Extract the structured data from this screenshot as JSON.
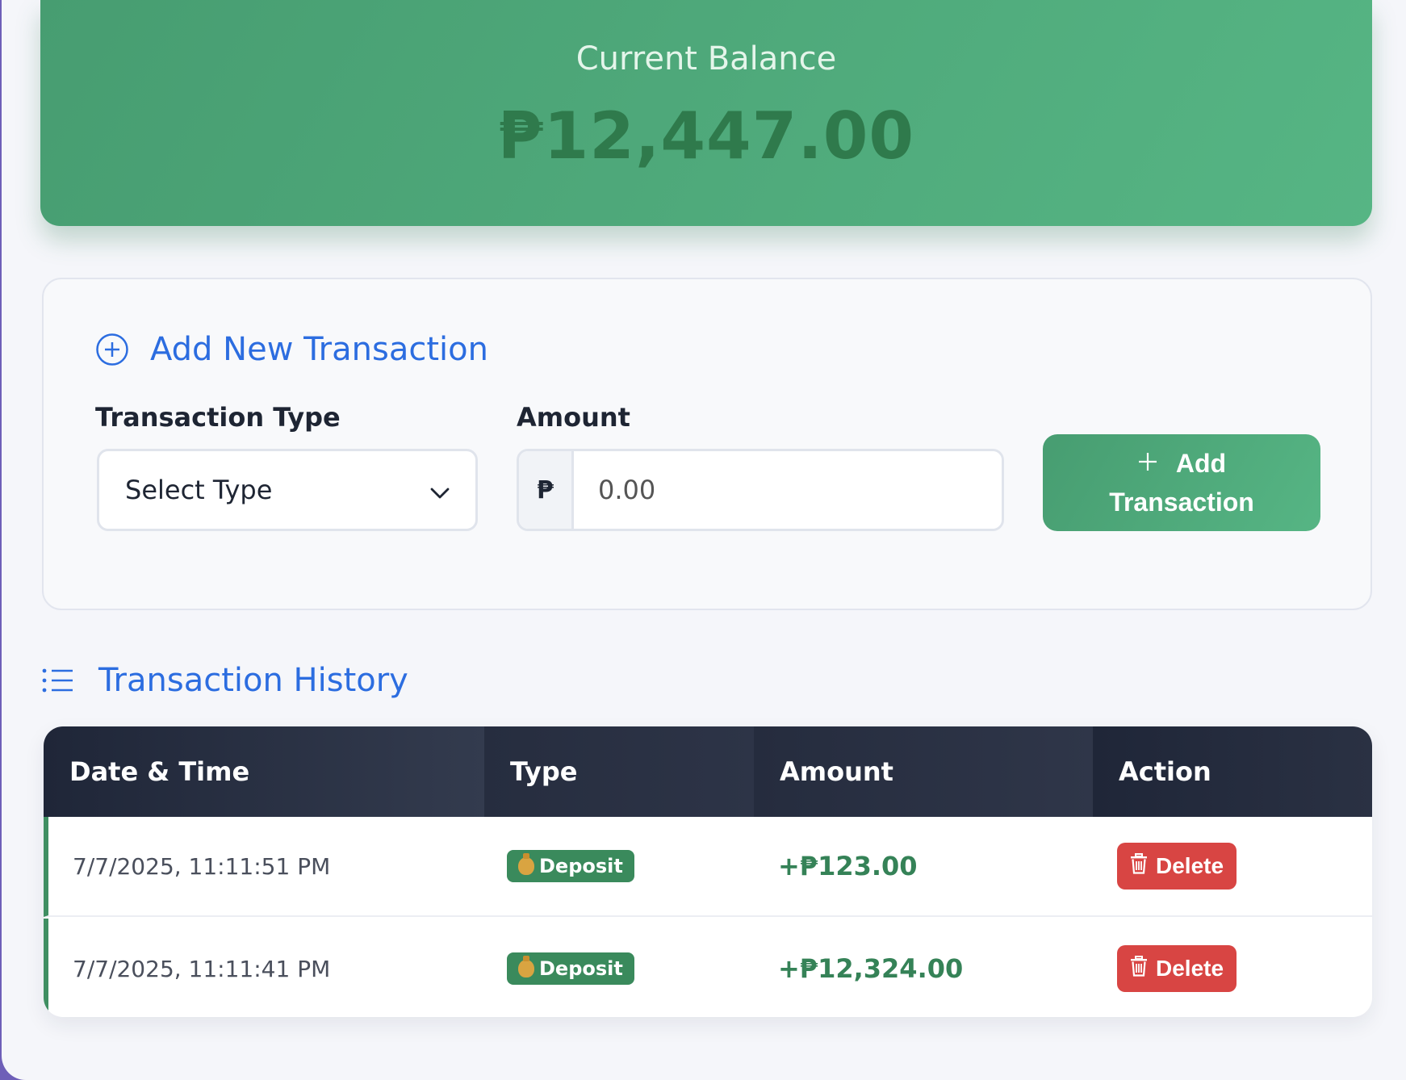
{
  "balance": {
    "label": "Current Balance",
    "value": "₱12,447.00"
  },
  "form": {
    "title": "Add New Transaction",
    "type_label": "Transaction Type",
    "type_selected": "Select Type",
    "amount_label": "Amount",
    "currency_symbol": "₱",
    "amount_placeholder": "0.00",
    "submit_line1": "Add",
    "submit_line2": "Transaction"
  },
  "history": {
    "title": "Transaction History",
    "columns": [
      "Date & Time",
      "Type",
      "Amount",
      "Action"
    ],
    "rows": [
      {
        "datetime": "7/7/2025, 11:11:51 PM",
        "type": "Deposit",
        "amount": "+₱123.00",
        "action": "Delete"
      },
      {
        "datetime": "7/7/2025, 11:11:41 PM",
        "type": "Deposit",
        "amount": "+₱12,324.00",
        "action": "Delete"
      }
    ]
  },
  "colors": {
    "accent_green": "#479d71",
    "link_blue": "#2c6de0",
    "delete_red": "#d84543"
  },
  "icons": {
    "form_title": "plus-circle-icon",
    "submit": "plus-icon",
    "history_title": "list-icon",
    "deposit_badge": "money-bag-icon",
    "delete": "trash-icon",
    "select_caret": "chevron-down-icon"
  }
}
